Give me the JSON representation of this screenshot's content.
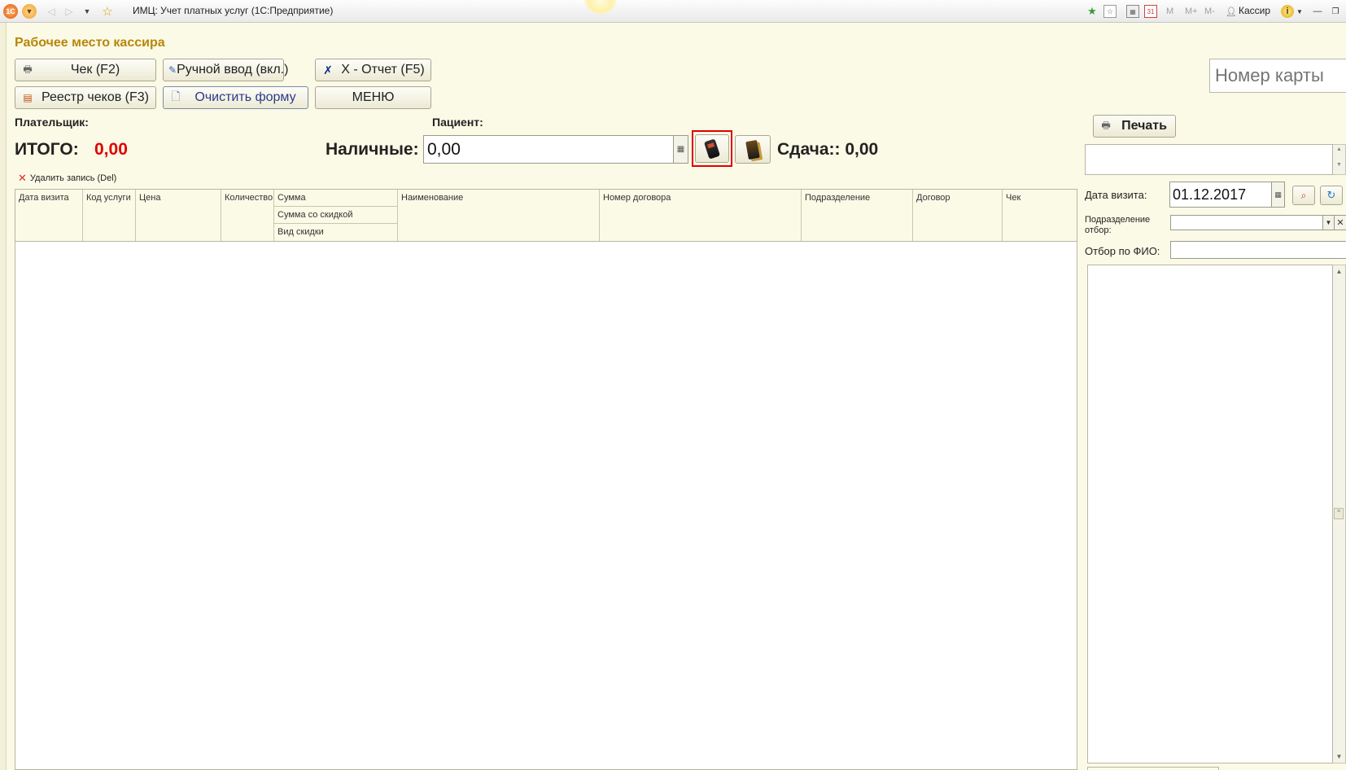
{
  "window": {
    "title": "ИМЦ: Учет платных услуг  (1С:Предприятие)",
    "user": "Кассир",
    "memory_buttons": [
      "M",
      "M+",
      "M-"
    ],
    "icons": [
      "app-logo-icon",
      "main-menu-icon",
      "back-icon",
      "forward-icon",
      "history-icon",
      "favorite-icon",
      "favorites-list-icon",
      "bookmark-icon",
      "calculator-icon",
      "calendar-icon",
      "user-icon",
      "info-icon",
      "minimize-icon",
      "restore-icon"
    ]
  },
  "form": {
    "title": "Рабочее место кассира"
  },
  "toolbar": {
    "check": "Чек (F2)",
    "manual": "Ручной ввод (вкл.)",
    "xreport": "X - Отчет (F5)",
    "registry": "Реестр чеков (F3)",
    "clear": "Очистить форму",
    "menu": "МЕНЮ"
  },
  "card": {
    "placeholder": "Номер карты"
  },
  "labels": {
    "payer": "Плательщик:",
    "patient": "Пациент:",
    "total_label": "ИТОГО:",
    "total_value": "0,00",
    "cash_label": "Наличные:",
    "change": "Сдача:: 0,00"
  },
  "cash": {
    "value": "0,00"
  },
  "table": {
    "delete_record": "Удалить запись (Del)",
    "columns": {
      "visit_date": "Дата визита",
      "service_code": "Код услуги",
      "price": "Цена",
      "quantity": "Количество",
      "sum": "Сумма",
      "sum_discount": "Сумма со скидкой",
      "discount_type": "Вид скидки",
      "name": "Наименование",
      "contract_number": "Номер договора",
      "department": "Подразделение",
      "contract": "Договор",
      "check": "Чек"
    }
  },
  "right_panel": {
    "print": "Печать",
    "visit_date_label": "Дата визита:",
    "visit_date_value": "01.12.2017",
    "dept_filter_label": "Подразделение отбор:",
    "fio_filter_label": "Отбор по ФИО:"
  },
  "colors": {
    "accent_title": "#b8860b",
    "total_red": "#e00000",
    "highlight_red": "#e00000",
    "background": "#fbfae6"
  }
}
